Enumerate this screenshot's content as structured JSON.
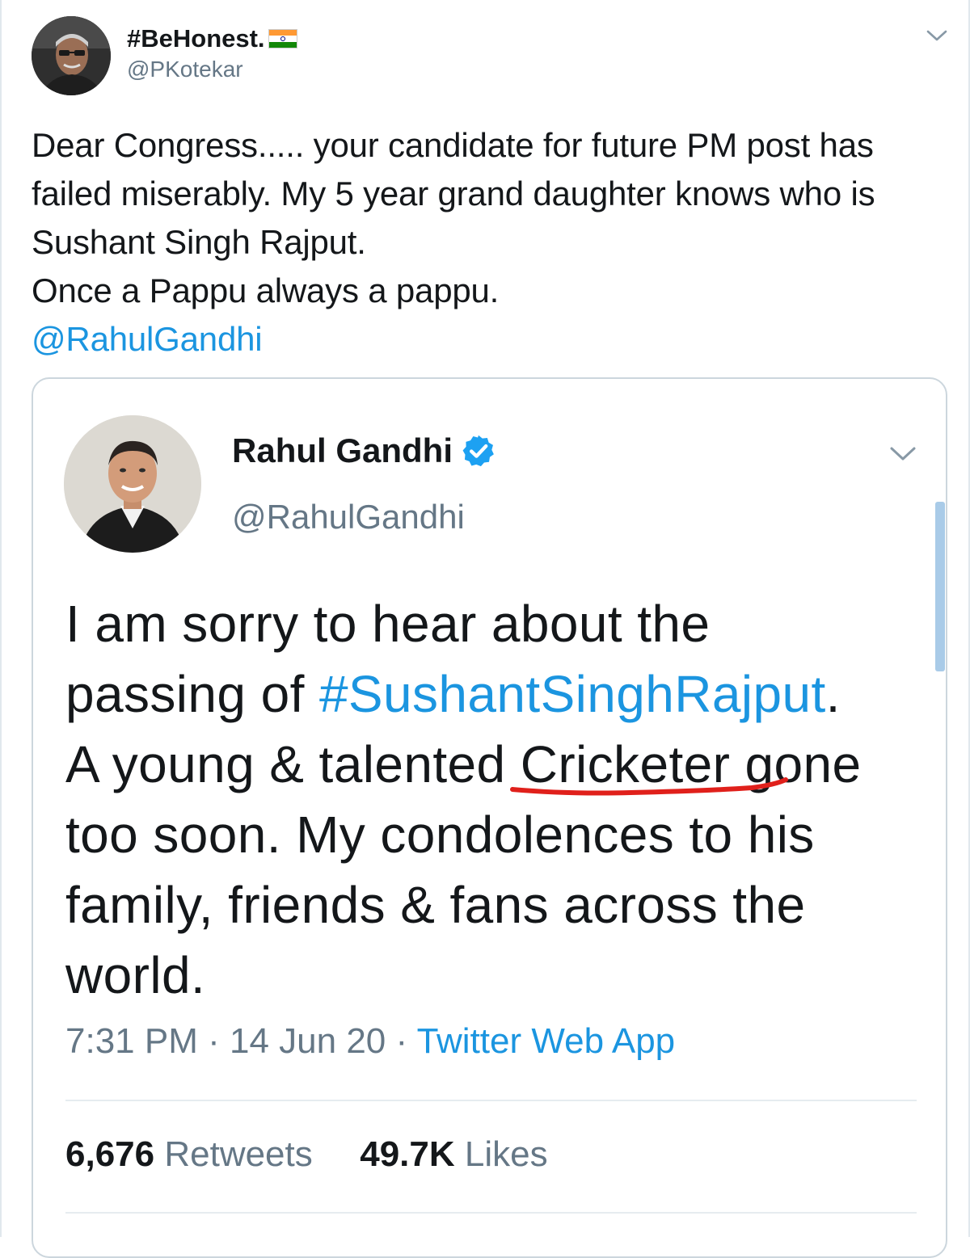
{
  "outer_tweet": {
    "display_name": "#BeHonest.",
    "handle": "@PKotekar",
    "text_lines": [
      "Dear Congress..... your candidate for future PM post has",
      "failed miserably. My 5 year grand daughter knows who is",
      "Sushant Singh Rajput.",
      "Once a Pappu always a pappu."
    ],
    "mention": "@RahulGandhi",
    "icons": {
      "flag": "india-flag-icon",
      "menu": "chevron-down-icon"
    }
  },
  "quoted_tweet": {
    "display_name": "Rahul Gandhi",
    "handle": "@RahulGandhi",
    "verified_icon": "verified-badge-icon",
    "text": {
      "line1": "I am sorry to hear about the",
      "line2_prefix": "passing of ",
      "hashtag": "#SushantSinghRajput",
      "line2_suffix": ".",
      "line3_prefix": "A young & talented ",
      "line3_underlined": "Cricketer gone",
      "line4": "too soon. My condolences to his",
      "line5": "family, friends & fans across the",
      "line6": "world."
    },
    "time": "7:31 PM",
    "separator": " · ",
    "date": "14 Jun 20",
    "source": "Twitter Web App",
    "retweets_count": "6,676",
    "retweets_label": "Retweets",
    "likes_count": "49.7K",
    "likes_label": "Likes"
  },
  "colors": {
    "link_blue": "#1b95e0",
    "secondary_text": "#657786",
    "annotation_red": "#e0201b",
    "border": "#ccd6dd"
  }
}
